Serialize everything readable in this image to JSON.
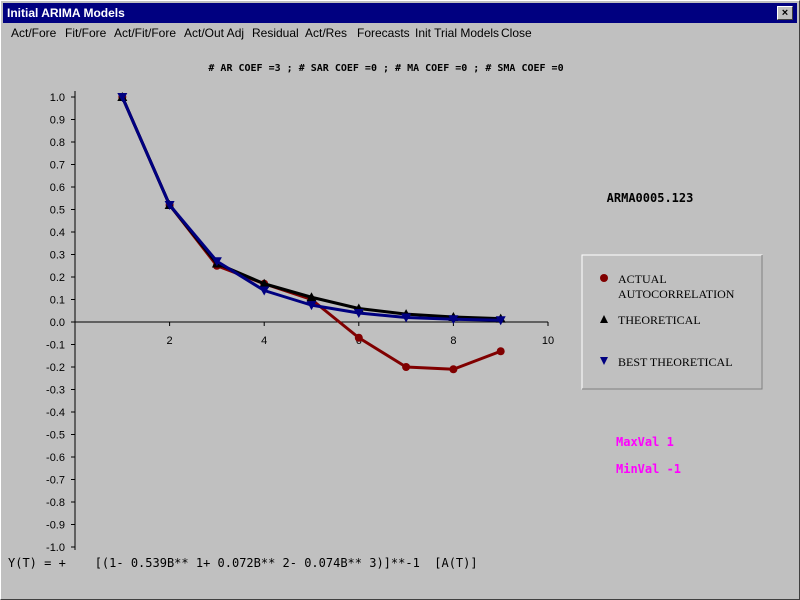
{
  "window": {
    "title": "Initial ARIMA Models",
    "close_glyph": "×"
  },
  "menu": [
    "Act/Fore",
    "Fit/Fore",
    "Act/Fit/Fore",
    "Act/Out Adj",
    "Residual",
    "Act/Res",
    "Forecasts",
    "Init Trial Models",
    "Close"
  ],
  "chart_heading": "# AR COEF =3 ; # SAR COEF =0 ; # MA COEF =0 ; # SMA COEF =0",
  "series_label": "ARMA0005.123",
  "maxval_label": "MaxVal 1",
  "minval_label": "MinVal -1",
  "equation": "Y(T) = +    [(1- 0.539B** 1+ 0.072B** 2- 0.074B** 3)]**-1  [A(T)]",
  "legend": {
    "actual_line1": "ACTUAL",
    "actual_line2": "AUTOCORRELATION",
    "theoretical": "THEORETICAL",
    "best": "BEST THEORETICAL"
  },
  "colors": {
    "actual": "#800000",
    "theoretical": "#000000",
    "best": "#000080",
    "minmax": "#ff00ff"
  },
  "chart_data": {
    "type": "line",
    "xlim": [
      0,
      10
    ],
    "ylim": [
      -1.0,
      1.0
    ],
    "x_ticks": [
      2,
      4,
      6,
      8,
      10
    ],
    "y_ticks": [
      "1.0",
      "0.9",
      "0.8",
      "0.7",
      "0.6",
      "0.5",
      "0.4",
      "0.3",
      "0.2",
      "0.1",
      "0.0",
      "-0.1",
      "-0.2",
      "-0.3",
      "-0.4",
      "-0.5",
      "-0.6",
      "-0.7",
      "-0.8",
      "-0.9",
      "-1.0"
    ],
    "series": [
      {
        "key": "actual",
        "name": "ACTUAL AUTOCORRELATION",
        "marker": "circle",
        "x": [
          1,
          2,
          3,
          4,
          5,
          6,
          7,
          8,
          9
        ],
        "y": [
          1.0,
          0.52,
          0.25,
          0.17,
          0.1,
          -0.07,
          -0.2,
          -0.21,
          -0.13
        ]
      },
      {
        "key": "theoretical",
        "name": "THEORETICAL",
        "marker": "triangle-up",
        "x": [
          1,
          2,
          3,
          4,
          5,
          6,
          7,
          8,
          9
        ],
        "y": [
          1.0,
          0.52,
          0.26,
          0.17,
          0.11,
          0.06,
          0.035,
          0.022,
          0.015
        ]
      },
      {
        "key": "best",
        "name": "BEST THEORETICAL",
        "marker": "triangle-down",
        "x": [
          1,
          2,
          3,
          4,
          5,
          6,
          7,
          8,
          9
        ],
        "y": [
          1.0,
          0.52,
          0.27,
          0.14,
          0.075,
          0.04,
          0.02,
          0.012,
          0.008
        ]
      }
    ]
  }
}
